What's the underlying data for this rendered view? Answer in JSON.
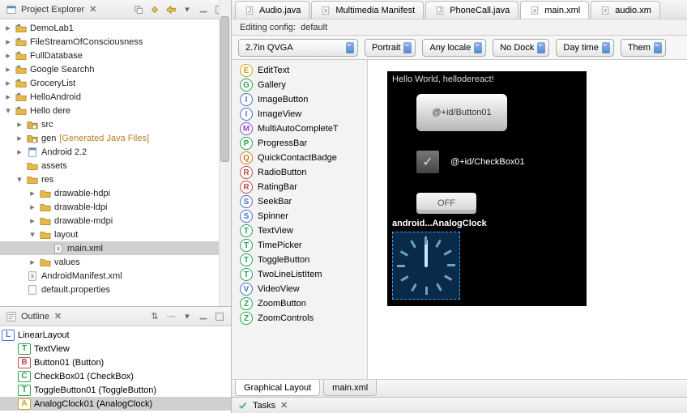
{
  "project_explorer": {
    "title": "Project Explorer",
    "items": [
      {
        "depth": 0,
        "disc": "right",
        "icon": "project",
        "label": "DemoLab1"
      },
      {
        "depth": 0,
        "disc": "right",
        "icon": "project",
        "label": "FileStreamOfConsciousness"
      },
      {
        "depth": 0,
        "disc": "right",
        "icon": "project",
        "label": "FullDatabase"
      },
      {
        "depth": 0,
        "disc": "right",
        "icon": "project",
        "label": "Google Searchh"
      },
      {
        "depth": 0,
        "disc": "right",
        "icon": "project",
        "label": "GroceryList"
      },
      {
        "depth": 0,
        "disc": "right",
        "icon": "project",
        "label": "HelloAndroid"
      },
      {
        "depth": 0,
        "disc": "down",
        "icon": "project",
        "label": "Hello dere"
      },
      {
        "depth": 1,
        "disc": "right",
        "icon": "srcfolder",
        "label": "src"
      },
      {
        "depth": 1,
        "disc": "right",
        "icon": "srcfolder",
        "label": "gen",
        "suffix": "[Generated Java Files]"
      },
      {
        "depth": 1,
        "disc": "right",
        "icon": "lib",
        "label": "Android 2.2"
      },
      {
        "depth": 1,
        "disc": "none",
        "icon": "folder",
        "label": "assets"
      },
      {
        "depth": 1,
        "disc": "down",
        "icon": "folder",
        "label": "res"
      },
      {
        "depth": 2,
        "disc": "right",
        "icon": "folder",
        "label": "drawable-hdpi"
      },
      {
        "depth": 2,
        "disc": "right",
        "icon": "folder",
        "label": "drawable-ldpi"
      },
      {
        "depth": 2,
        "disc": "right",
        "icon": "folder",
        "label": "drawable-mdpi"
      },
      {
        "depth": 2,
        "disc": "down",
        "icon": "folder",
        "label": "layout"
      },
      {
        "depth": 3,
        "disc": "none",
        "icon": "xml",
        "label": "main.xml",
        "selected": true
      },
      {
        "depth": 2,
        "disc": "right",
        "icon": "folder",
        "label": "values"
      },
      {
        "depth": 1,
        "disc": "none",
        "icon": "xml",
        "label": "AndroidManifest.xml"
      },
      {
        "depth": 1,
        "disc": "none",
        "icon": "file",
        "label": "default.properties"
      }
    ]
  },
  "outline": {
    "title": "Outline",
    "root": {
      "letter": "L",
      "cls": "col-L",
      "label": "LinearLayout"
    },
    "children": [
      {
        "letter": "T",
        "cls": "col-T",
        "label": "TextView"
      },
      {
        "letter": "B",
        "cls": "col-B",
        "label": "Button01 (Button)"
      },
      {
        "letter": "C",
        "cls": "col-C",
        "label": "CheckBox01 (CheckBox)"
      },
      {
        "letter": "T",
        "cls": "col-T",
        "label": "ToggleButton01 (ToggleButton)"
      },
      {
        "letter": "A",
        "cls": "col-A",
        "label": "AnalogClock01 (AnalogClock)",
        "selected": true
      }
    ]
  },
  "editor_tabs": [
    {
      "icon": "java",
      "label": "Audio.java"
    },
    {
      "icon": "xml",
      "label": "Multimedia Manifest"
    },
    {
      "icon": "java",
      "label": "PhoneCall.java"
    },
    {
      "icon": "xml",
      "label": "main.xml",
      "active": true
    },
    {
      "icon": "xml",
      "label": "audio.xm"
    }
  ],
  "editing": {
    "prefix": "Editing config:",
    "value": "default"
  },
  "config": {
    "resolution": "2.7in QVGA",
    "orientation": "Portrait",
    "locale": "Any locale",
    "dock": "No Dock",
    "daynight": "Day time",
    "theme": "Them"
  },
  "palette": [
    {
      "l": "E",
      "c": "pc-E",
      "label": "EditText"
    },
    {
      "l": "G",
      "c": "pc-G",
      "label": "Gallery"
    },
    {
      "l": "I",
      "c": "pc-I",
      "label": "ImageButton"
    },
    {
      "l": "I",
      "c": "pc-I",
      "label": "ImageView"
    },
    {
      "l": "M",
      "c": "pc-M",
      "label": "MultiAutoCompleteT"
    },
    {
      "l": "P",
      "c": "pc-P",
      "label": "ProgressBar"
    },
    {
      "l": "Q",
      "c": "pc-Q",
      "label": "QuickContactBadge"
    },
    {
      "l": "R",
      "c": "pc-R",
      "label": "RadioButton"
    },
    {
      "l": "R",
      "c": "pc-R",
      "label": "RatingBar"
    },
    {
      "l": "S",
      "c": "pc-S",
      "label": "SeekBar"
    },
    {
      "l": "S",
      "c": "pc-S",
      "label": "Spinner"
    },
    {
      "l": "T",
      "c": "pc-T",
      "label": "TextView"
    },
    {
      "l": "T",
      "c": "pc-T",
      "label": "TimePicker"
    },
    {
      "l": "T",
      "c": "pc-T",
      "label": "ToggleButton"
    },
    {
      "l": "T",
      "c": "pc-T",
      "label": "TwoLineListItem"
    },
    {
      "l": "V",
      "c": "pc-V",
      "label": "VideoView"
    },
    {
      "l": "Z",
      "c": "pc-Z",
      "label": "ZoomButton"
    },
    {
      "l": "Z",
      "c": "pc-Z",
      "label": "ZoomControls"
    }
  ],
  "canvas": {
    "hello": "Hello World, hellodereact!",
    "button": "@+id/Button01",
    "checkbox": "@+id/CheckBox01",
    "toggle": "OFF",
    "selection": "android...AnalogClock"
  },
  "bottom_tabs": {
    "graphical": "Graphical Layout",
    "xml": "main.xml"
  },
  "tasks": {
    "title": "Tasks"
  }
}
